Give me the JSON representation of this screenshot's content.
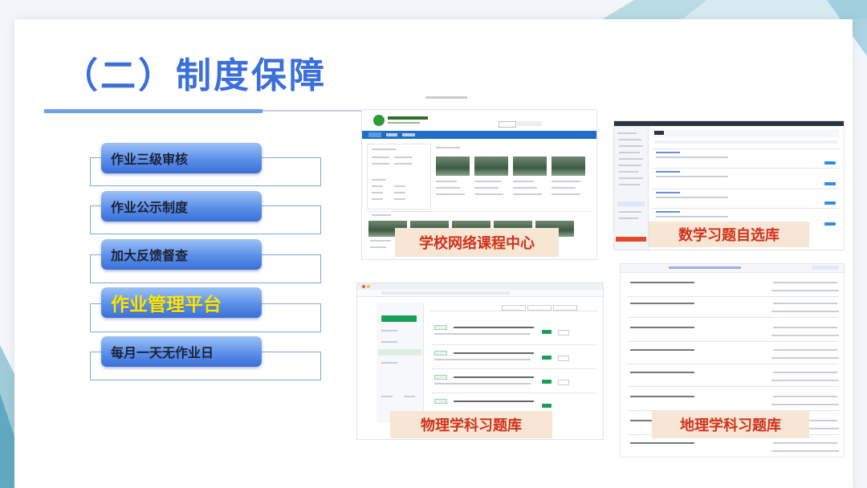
{
  "title": "（二）制度保障",
  "menu": [
    {
      "label": "作业三级审核",
      "active": false
    },
    {
      "label": "作业公示制度",
      "active": false
    },
    {
      "label": "加大反馈督查",
      "active": false
    },
    {
      "label": "作业管理平台",
      "active": true
    },
    {
      "label": "每月一天无作业日",
      "active": false
    }
  ],
  "captions": {
    "school_course": "学校网络课程中心",
    "math_bank": "数学习题自选库",
    "physics_bank": "物理学科习题库",
    "geography_bank": "地理学科习题库"
  },
  "colors": {
    "title_blue": "#3b6fd9",
    "active_label": "#ffe600",
    "caption_text": "#d0321c",
    "caption_bg": "#f7e6d4"
  }
}
